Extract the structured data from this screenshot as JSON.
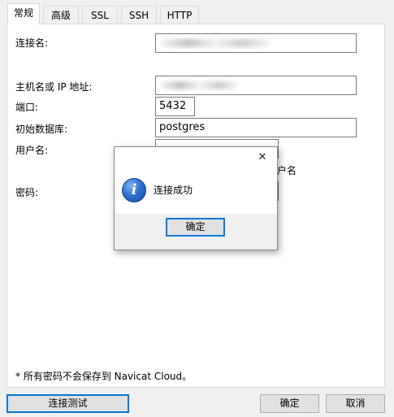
{
  "tabs": [
    {
      "label": "常规"
    },
    {
      "label": "高级"
    },
    {
      "label": "SSL"
    },
    {
      "label": "SSH"
    },
    {
      "label": "HTTP"
    }
  ],
  "form": {
    "connection_name_label": "连接名:",
    "host_label": "主机名或 IP 地址:",
    "port_label": "端口:",
    "port_value": "5432",
    "database_label": "初始数据库:",
    "database_value": "postgres",
    "username_label": "用户名:",
    "partial_label_behind_dialog": "户名",
    "password_label": "密码:"
  },
  "note": "* 所有密码不会保存到 Navicat Cloud。",
  "buttons": {
    "test": "连接测试",
    "ok": "确定",
    "cancel": "取消"
  },
  "dialog": {
    "close_glyph": "✕",
    "message": "连接成功",
    "ok": "确定",
    "info_glyph": "i"
  }
}
